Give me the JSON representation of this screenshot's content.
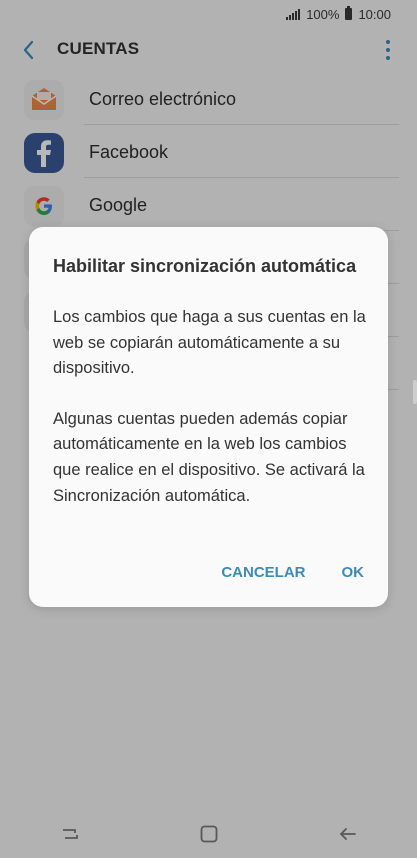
{
  "status_bar": {
    "battery_text": "100%",
    "time": "10:00"
  },
  "app_bar": {
    "title": "CUENTAS"
  },
  "accounts": [
    {
      "label": "Correo electrónico",
      "icon": "email-icon"
    },
    {
      "label": "Facebook",
      "icon": "facebook-icon"
    },
    {
      "label": "Google",
      "icon": "google-icon"
    }
  ],
  "dialog": {
    "title": "Habilitar sincronización automática",
    "paragraph1": "Los cambios que haga a sus cuentas en la web se copiarán automáticamente a su dispositivo.",
    "paragraph2": "Algunas cuentas pueden además copiar automáticamente en la web los cambios que realice en el dispositivo. Se activará la Sincronización automática.",
    "cancel_label": "CANCELAR",
    "ok_label": "OK"
  },
  "colors": {
    "accent": "#3b8bb3",
    "email_orange": "#f08a4b",
    "facebook_blue": "#3b5998"
  }
}
